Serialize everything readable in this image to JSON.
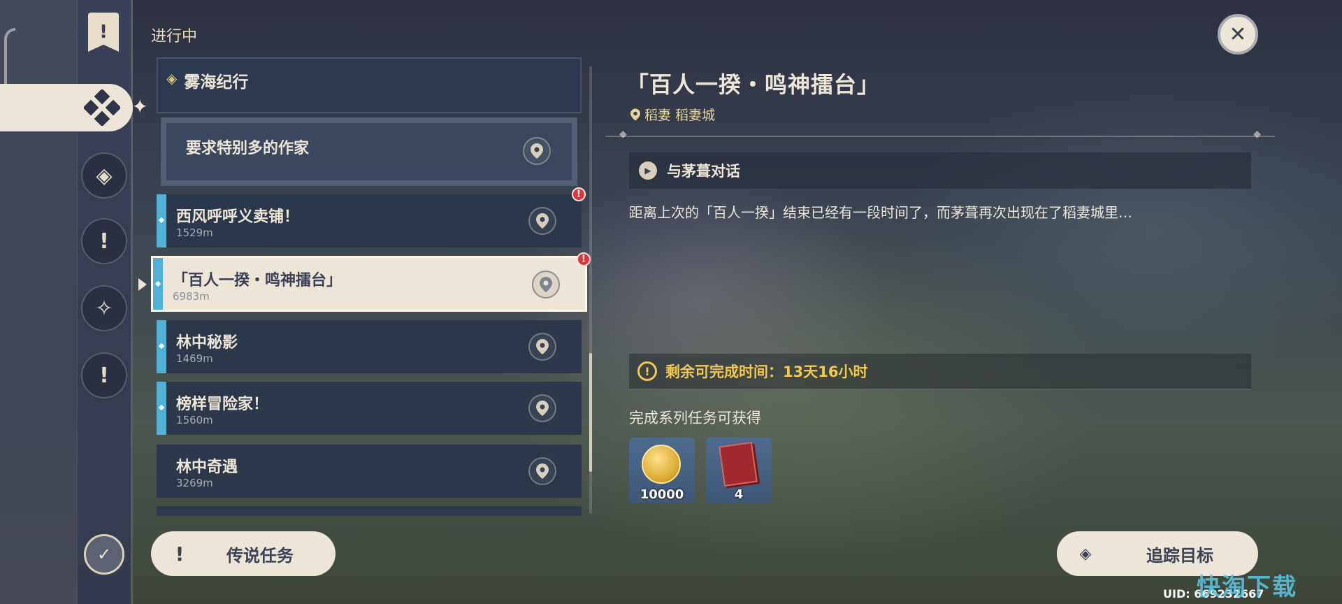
{
  "section_title": "进行中",
  "group": {
    "title": "雾海纪行"
  },
  "sub_quest": {
    "title": "要求特别多的作家"
  },
  "quests": [
    {
      "title": "西风呼呼义卖铺！",
      "distance": "1529m",
      "alert": "!"
    },
    {
      "title": "「百人一揆・鸣神擂台」",
      "distance": "6983m",
      "alert": "!"
    },
    {
      "title": "林中秘影",
      "distance": "1469m"
    },
    {
      "title": "榜样冒险家！",
      "distance": "1560m"
    },
    {
      "title": "林中奇遇",
      "distance": "3269m"
    }
  ],
  "legend_button": {
    "label": "传说任务"
  },
  "detail": {
    "title": "「百人一揆・鸣神擂台」",
    "location": "稻妻 稻妻城",
    "objective": "与茅葺对话",
    "description": "距离上次的「百人一揆」结束已经有一段时间了，而茅葺再次出现在了稻妻城里…",
    "timer": "剩余可完成时间：13天16小时",
    "rewards_title": "完成系列任务可获得",
    "rewards": [
      {
        "icon": "mora-icon",
        "count": "10000"
      },
      {
        "icon": "exp-book-icon",
        "count": "4"
      }
    ]
  },
  "track_button": {
    "label": "追踪目标"
  },
  "uid": "UID: 669232667",
  "watermark": "快淘下载",
  "colors": {
    "accent_cream": "#ece5d8",
    "quest_bar": "#4fb1d8",
    "timer_yellow": "#f2c94c",
    "alert_red": "#e0353f"
  }
}
